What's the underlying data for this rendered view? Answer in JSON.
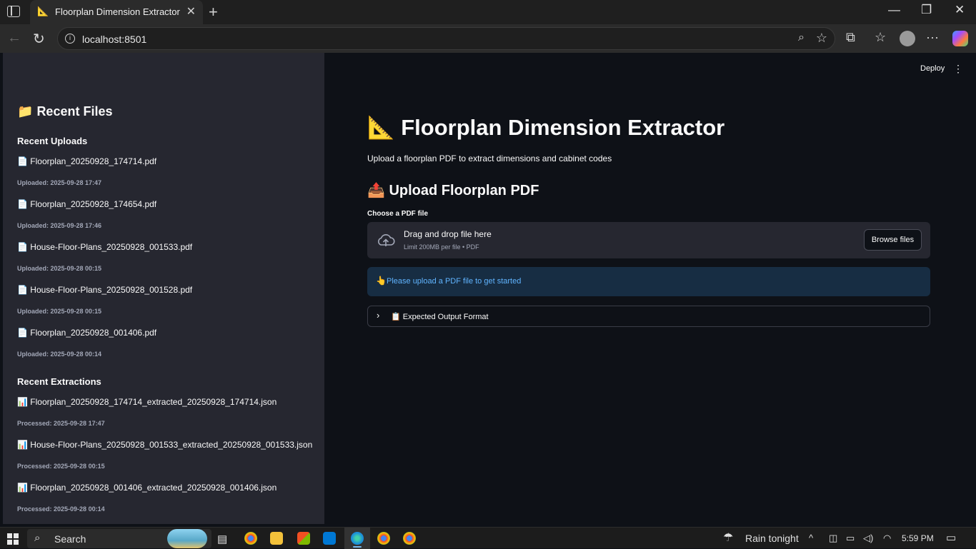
{
  "browser": {
    "tab_title": "Floorplan Dimension Extractor",
    "tab_icon": "📐",
    "url": "localhost:8501"
  },
  "sidebar": {
    "title_icon": "📁",
    "title": "Recent Files",
    "uploads_heading": "Recent Uploads",
    "uploads": [
      {
        "icon": "📄",
        "name": "Floorplan_20250928_174714.pdf",
        "meta": "Uploaded: 2025-09-28 17:47"
      },
      {
        "icon": "📄",
        "name": "Floorplan_20250928_174654.pdf",
        "meta": "Uploaded: 2025-09-28 17:46"
      },
      {
        "icon": "📄",
        "name": "House-Floor-Plans_20250928_001533.pdf",
        "meta": "Uploaded: 2025-09-28 00:15"
      },
      {
        "icon": "📄",
        "name": "House-Floor-Plans_20250928_001528.pdf",
        "meta": "Uploaded: 2025-09-28 00:15"
      },
      {
        "icon": "📄",
        "name": "Floorplan_20250928_001406.pdf",
        "meta": "Uploaded: 2025-09-28 00:14"
      }
    ],
    "extractions_heading": "Recent Extractions",
    "extractions": [
      {
        "icon": "📊",
        "name": "Floorplan_20250928_174714_extracted_20250928_174714.json",
        "meta": "Processed: 2025-09-28 17:47"
      },
      {
        "icon": "📊",
        "name": "House-Floor-Plans_20250928_001533_extracted_20250928_001533.json",
        "meta": "Processed: 2025-09-28 00:15"
      },
      {
        "icon": "📊",
        "name": "Floorplan_20250928_001406_extracted_20250928_001406.json",
        "meta": "Processed: 2025-09-28 00:14"
      }
    ]
  },
  "main": {
    "deploy_label": "Deploy",
    "title_icon": "📐",
    "title": "Floorplan Dimension Extractor",
    "subtitle": "Upload a floorplan PDF to extract dimensions and cabinet codes",
    "upload_icon": "📤",
    "upload_heading": "Upload Floorplan PDF",
    "uploader_label": "Choose a PDF file",
    "drop_text": "Drag and drop file here",
    "drop_limit": "Limit 200MB per file • PDF",
    "browse_label": "Browse files",
    "info_icon": "👆",
    "info_text": "Please upload a PDF file to get started",
    "expander_icon": "📋",
    "expander_label": "Expected Output Format"
  },
  "taskbar": {
    "search_label": "Search",
    "weather": "Rain tonight",
    "time": "5:59 PM"
  },
  "colors": {
    "app_bg": "#0e1117",
    "sidebar_bg": "#262730",
    "info_bg": "#172d43",
    "info_text": "#60b4ff"
  }
}
